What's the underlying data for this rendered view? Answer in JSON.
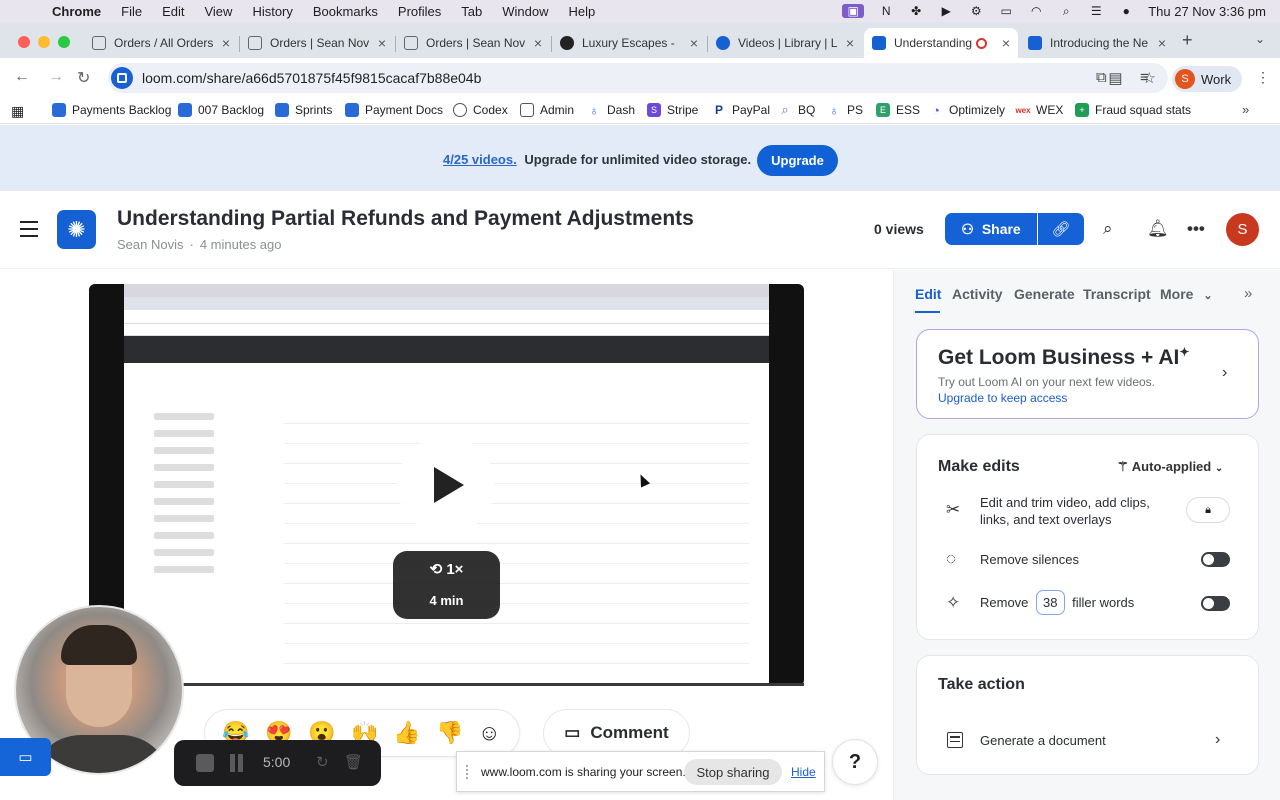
{
  "menubar": {
    "app": "Chrome",
    "items": [
      "File",
      "Edit",
      "View",
      "History",
      "Bookmarks",
      "Profiles",
      "Tab",
      "Window",
      "Help"
    ],
    "clock": "Thu 27 Nov  3:36 pm"
  },
  "tabs": [
    {
      "title": "Orders / All Orders",
      "favicon_color": "#7a7a7a"
    },
    {
      "title": "Orders | Sean Nov",
      "favicon_color": "#7a7a7a"
    },
    {
      "title": "Orders | Sean Nov",
      "favicon_color": "#7a7a7a"
    },
    {
      "title": "Luxury Escapes - ",
      "favicon_color": "#222222"
    },
    {
      "title": "Videos | Library | L",
      "favicon_color": "#1560d3"
    },
    {
      "title": "Understanding",
      "favicon_color": "#1560d3"
    },
    {
      "title": "Introducing the Ne",
      "favicon_color": "#1560d3"
    }
  ],
  "address": {
    "url": "loom.com/share/a66d5701875f45f9815cacaf7b88e04b",
    "profile_initial": "S",
    "profile_label": "Work"
  },
  "bookmarks": [
    {
      "label": "Payments Backlog",
      "color": "#2a6ad6"
    },
    {
      "label": "007 Backlog",
      "color": "#2a6ad6"
    },
    {
      "label": "Sprints",
      "color": "#2a6ad6"
    },
    {
      "label": "Payment Docs",
      "color": "#2a6ad6"
    },
    {
      "label": "Codex",
      "color": "#555555"
    },
    {
      "label": "Admin",
      "color": "#555555"
    },
    {
      "label": "Dash",
      "color": "#3a7be0"
    },
    {
      "label": "Stripe",
      "color": "#6c49d8"
    },
    {
      "label": "PayPal",
      "color": "#1b3f8f"
    },
    {
      "label": "BQ",
      "color": "#4a7ce0"
    },
    {
      "label": "PS",
      "color": "#3a7be0"
    },
    {
      "label": "ESS",
      "color": "#2ea26a"
    },
    {
      "label": "Optimizely",
      "color": "#4a5ad8"
    },
    {
      "label": "WEX",
      "color": "#d8322a"
    },
    {
      "label": "Fraud squad stats",
      "color": "#1f9d55"
    }
  ],
  "banner": {
    "count": "4/25 videos.",
    "message": "Upgrade for unlimited video storage.",
    "button": "Upgrade"
  },
  "header": {
    "title": "Understanding Partial Refunds and Payment Adjustments",
    "author": "Sean Novis",
    "time_ago": "4 minutes ago",
    "views": "0 views",
    "share": "Share",
    "avatar_initial": "S"
  },
  "player": {
    "speed": "1×",
    "duration": "4 min"
  },
  "comment": "Comment",
  "help": "?",
  "recorder": {
    "time": "5:00"
  },
  "sharebar": {
    "message": "www.loom.com is sharing your screen.",
    "stop": "Stop sharing",
    "hide": "Hide"
  },
  "panel": {
    "tabs": [
      "Edit",
      "Activity",
      "Generate",
      "Transcript",
      "More"
    ],
    "ai": {
      "title": "Get Loom Business + AI",
      "sparkle": "✦",
      "subtitle": "Try out Loom AI on your next few videos.",
      "link": "Upgrade to keep access"
    },
    "edits": {
      "title": "Make edits",
      "auto": "Auto-applied",
      "trim_line1": "Edit and trim video, add clips,",
      "trim_line2": "links, and text overlays",
      "silences": "Remove silences",
      "filler_prefix": "Remove",
      "filler_count": "38",
      "filler_suffix": "filler words"
    },
    "action": {
      "title": "Take action",
      "generate_doc": "Generate a document"
    }
  }
}
